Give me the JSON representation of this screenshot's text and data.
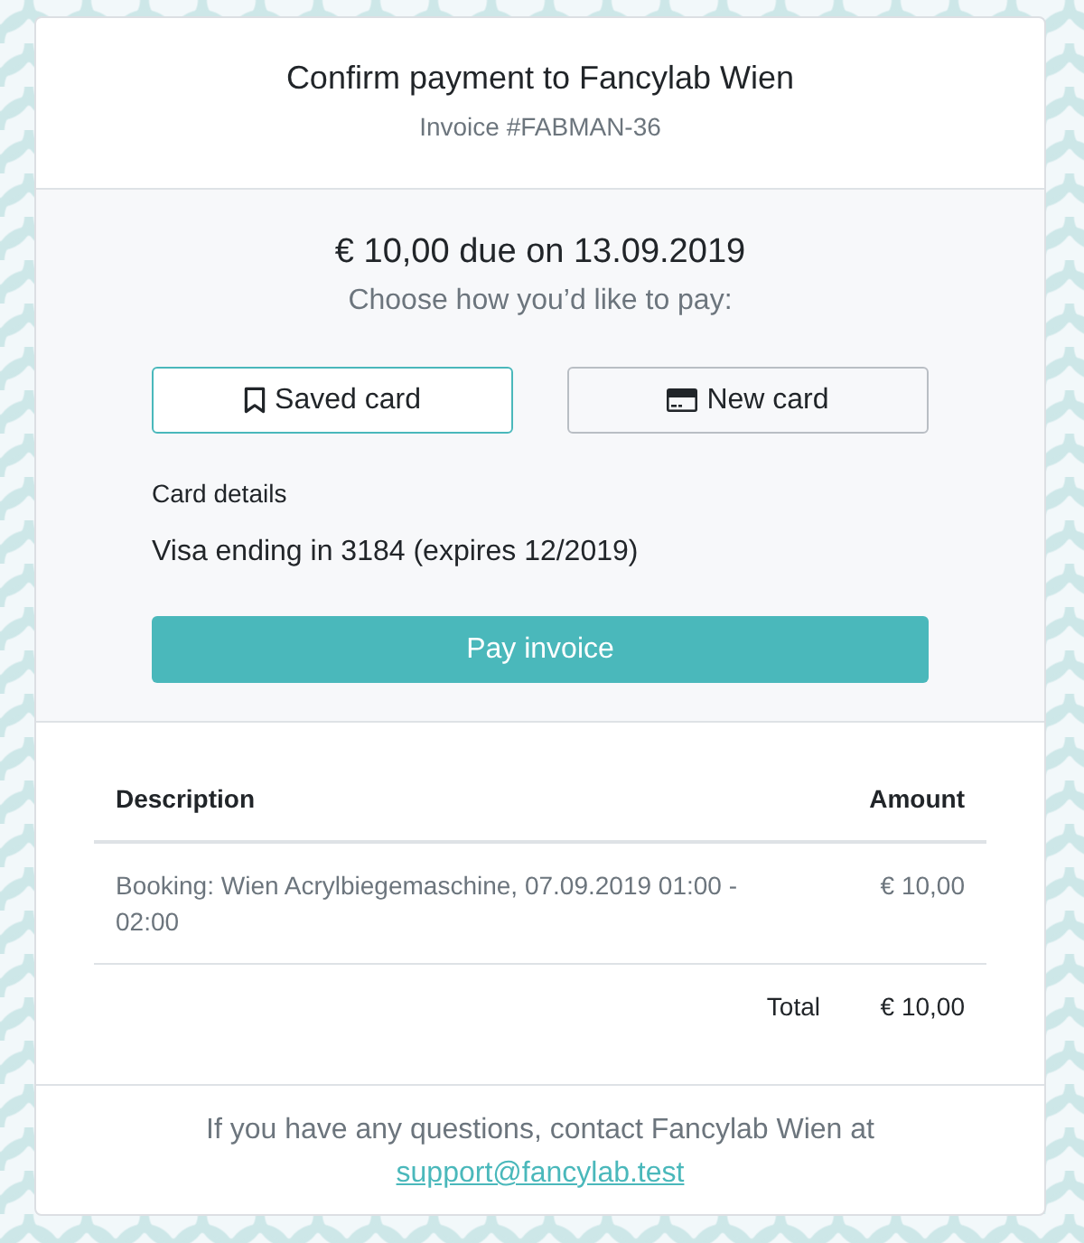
{
  "header": {
    "title": "Confirm payment to Fancylab Wien",
    "subtitle": "Invoice #FABMAN-36"
  },
  "payment": {
    "amount_due": "€ 10,00 due on 13.09.2019",
    "prompt": "Choose how you’d like to pay:",
    "methods": [
      {
        "kind": "saved",
        "label": "Saved card",
        "selected": true
      },
      {
        "kind": "new",
        "label": "New card",
        "selected": false
      }
    ],
    "card_details_label": "Card details",
    "card_details": "Visa ending in 3184 (expires 12/2019)",
    "pay_button": "Pay invoice"
  },
  "table": {
    "columns": [
      "Description",
      "Amount"
    ],
    "rows": [
      {
        "description": "Booking: Wien Acrylbiegemaschine, 07.09.2019 01:00 - 02:00",
        "amount": "€ 10,00"
      }
    ],
    "total_label": "Total",
    "total_amount": "€ 10,00"
  },
  "footer": {
    "text": "If you have any questions, contact Fancylab Wien at",
    "link": "support@fancylab.test"
  }
}
